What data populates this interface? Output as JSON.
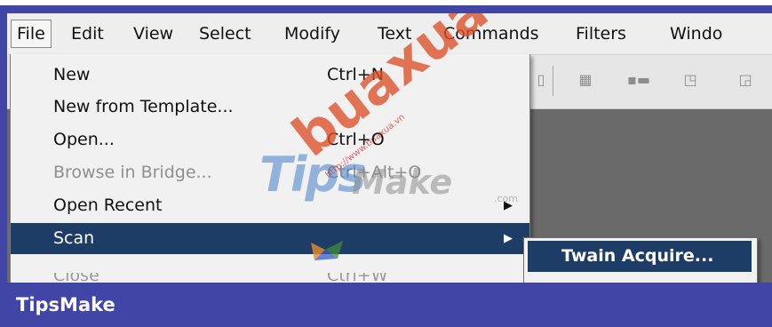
{
  "menubar": {
    "items": [
      "File",
      "Edit",
      "View",
      "Select",
      "Modify",
      "Text",
      "Commands",
      "Filters",
      "Windo"
    ]
  },
  "file_menu": {
    "items": [
      {
        "label": "New",
        "shortcut": "Ctrl+N"
      },
      {
        "label": "New from Template...",
        "shortcut": ""
      },
      {
        "label": "Open...",
        "shortcut": "Ctrl+O"
      },
      {
        "label": "Browse in Bridge...",
        "shortcut": "Ctrl+Alt+O"
      },
      {
        "label": "Open Recent",
        "shortcut": ""
      },
      {
        "label": "Scan",
        "shortcut": ""
      },
      {
        "label": "Close",
        "shortcut": "Ctrl+W"
      }
    ]
  },
  "scan_submenu": {
    "items": [
      "Twain Acquire..."
    ]
  },
  "watermark": {
    "tips": "Tips",
    "make": "Make",
    "com": ".com",
    "bua": "buaxua",
    "url": "http://www.buaxua.vn"
  },
  "footer": {
    "brand": "TipsMake"
  },
  "colors": {
    "frame": "#4146a6",
    "highlight": "#1e3d66",
    "menu_bg": "#f1f1f1"
  }
}
